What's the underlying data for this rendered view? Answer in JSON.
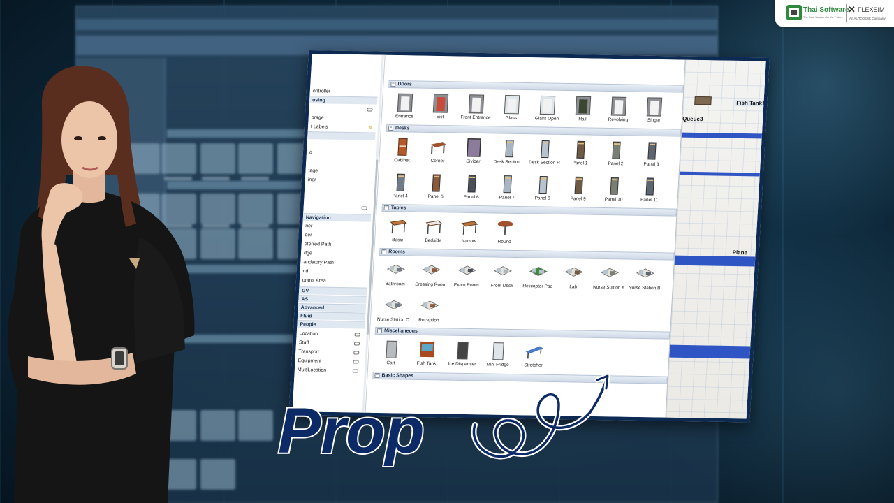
{
  "branding": {
    "thai_software": "Thai Software",
    "thai_tagline": "The Best Solution for the Future",
    "flexsim": "FLEXSIM",
    "autodesk": "An AUTODESK Company"
  },
  "title": "Prop",
  "colors": {
    "frame_border": "#0c2a52",
    "title_fill": "#0c2a66",
    "section_header": "#dfe7f1",
    "floor_stripe": "#2f55c4"
  },
  "sidebar": {
    "rows": [
      {
        "label": "ontroller",
        "type": "row"
      },
      {
        "label": "using",
        "type": "head"
      },
      {
        "label": "",
        "type": "row",
        "toggle": true
      },
      {
        "label": "orage",
        "type": "row"
      },
      {
        "label": "t Labels",
        "type": "row",
        "icon": "pencil-icon"
      },
      {
        "label": "",
        "type": "head"
      },
      {
        "label": "",
        "type": "row"
      },
      {
        "label": "d",
        "type": "row"
      },
      {
        "label": "",
        "type": "row"
      },
      {
        "label": "tage",
        "type": "row"
      },
      {
        "label": "iner",
        "type": "row"
      },
      {
        "label": "",
        "type": "row"
      },
      {
        "label": "",
        "type": "row"
      },
      {
        "label": "",
        "type": "row",
        "toggle": true
      },
      {
        "label": "Navigation",
        "type": "head"
      },
      {
        "label": "ner",
        "type": "row"
      },
      {
        "label": "der",
        "type": "row"
      },
      {
        "label": "eferred Path",
        "type": "row"
      },
      {
        "label": "dge",
        "type": "row"
      },
      {
        "label": "andatory Path",
        "type": "row"
      },
      {
        "label": "nd",
        "type": "row"
      },
      {
        "label": "ontrol Area",
        "type": "row"
      },
      {
        "label": "GV",
        "type": "head"
      },
      {
        "label": "AS",
        "type": "head"
      },
      {
        "label": "Advanced",
        "type": "head"
      },
      {
        "label": "Fluid",
        "type": "head"
      },
      {
        "label": "People",
        "type": "head"
      },
      {
        "label": "Location",
        "type": "row",
        "toggle": true
      },
      {
        "label": "Staff",
        "type": "row",
        "toggle": true
      },
      {
        "label": "Transport",
        "type": "row",
        "toggle": true
      },
      {
        "label": "Equipment",
        "type": "row",
        "toggle": true
      },
      {
        "label": "MultiLocation",
        "type": "row",
        "toggle": true
      }
    ]
  },
  "library": {
    "sections": [
      {
        "name": "Doors",
        "items": [
          "Entrance",
          "Exit",
          "Front Entrance",
          "Glass",
          "Glass Open",
          "Hall",
          "Revolving",
          "Single"
        ]
      },
      {
        "name": "Desks",
        "items": [
          "Cabinet",
          "Corner",
          "Divider",
          "Desk Section L",
          "Desk Section R",
          "Panel 1",
          "Panel 2",
          "Panel 3",
          "Panel 4",
          "Panel 5",
          "Panel 6",
          "Panel 7",
          "Panel 8",
          "Panel 9",
          "Panel 10",
          "Panel 11"
        ]
      },
      {
        "name": "Tables",
        "items": [
          "Basic",
          "Bedside",
          "Narrow",
          "Round"
        ]
      },
      {
        "name": "Rooms",
        "items": [
          "Bathroom",
          "Dressing Room",
          "Exam Room",
          "Front Desk",
          "Helicopter Pad",
          "Lab",
          "Nurse Station A",
          "Nurse Station B",
          "Nurse Station C",
          "Reception"
        ]
      },
      {
        "name": "Miscellaneous",
        "items": [
          "Cart",
          "Fish Tank",
          "Ice Dispenser",
          "Mini Fridge",
          "Stretcher"
        ]
      },
      {
        "name": "Basic Shapes",
        "items": []
      }
    ]
  },
  "view3d": {
    "labels": [
      "Fish Tank1",
      "Queue3",
      "Plane"
    ]
  }
}
